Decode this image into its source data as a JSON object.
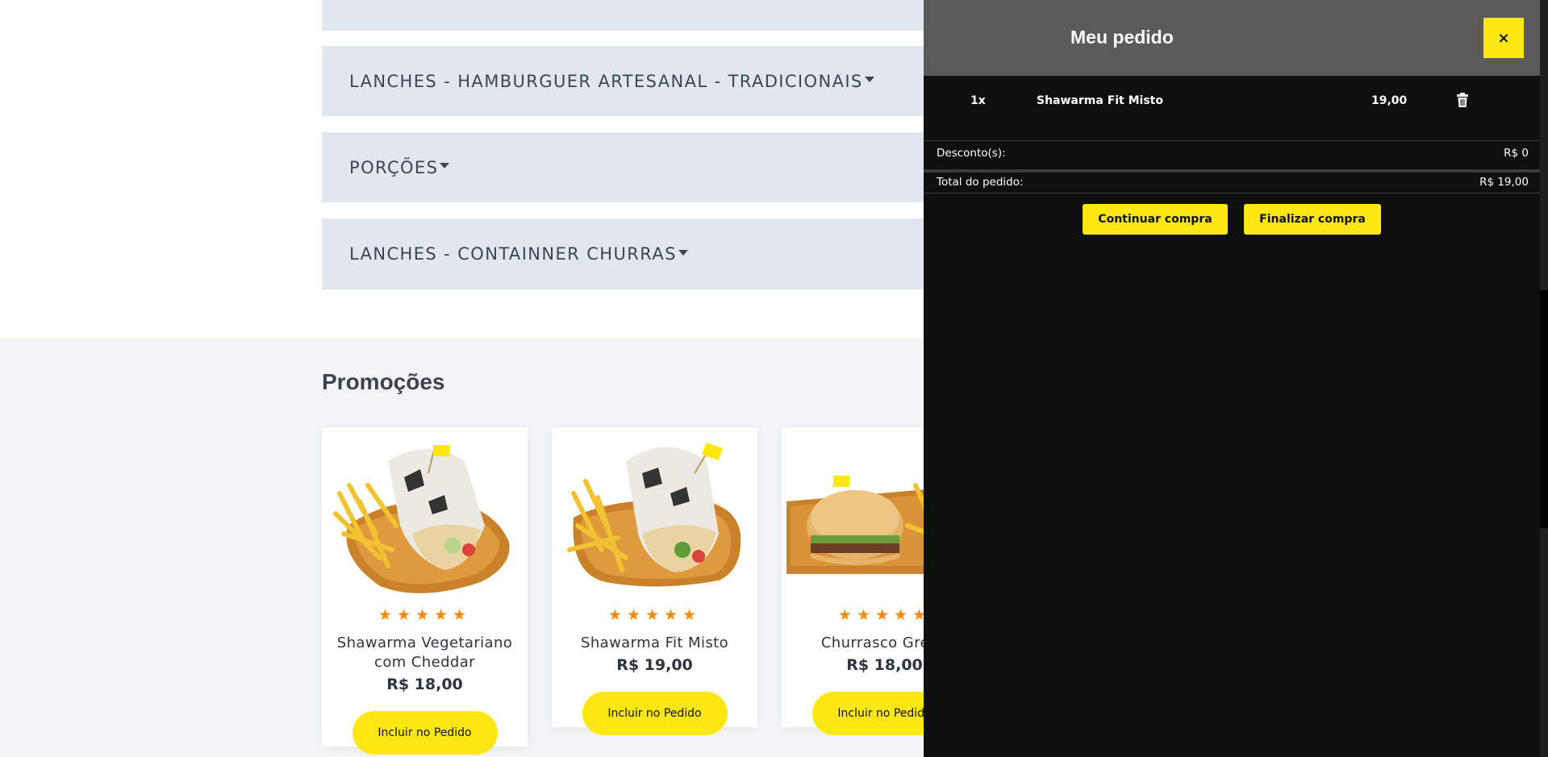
{
  "categories": [
    {
      "label": ""
    },
    {
      "label": "LANCHES - HAMBURGUER ARTESANAL - TRADICIONAIS"
    },
    {
      "label": "PORÇÕES"
    },
    {
      "label": "LANCHES - CONTAINNER CHURRAS"
    }
  ],
  "promotions": {
    "title": "Promoções",
    "products": [
      {
        "name": "Shawarma Vegetariano com Cheddar",
        "price": "R$ 18,00",
        "rating": 5,
        "button": "Incluir no Pedido",
        "image_icon": "wrap-with-fries-image"
      },
      {
        "name": "Shawarma Fit Misto",
        "price": "R$ 19,00",
        "rating": 5,
        "button": "Incluir no Pedido",
        "image_icon": "wrap-with-fries-image"
      },
      {
        "name": "Churrasco Grego",
        "price": "R$ 18,00",
        "rating": 5,
        "button": "Incluir no Pedido",
        "image_icon": "burger-with-fries-image"
      }
    ]
  },
  "drawer": {
    "title": "Meu pedido",
    "close_label": "×",
    "items": [
      {
        "qty": "1x",
        "name": "Shawarma Fit Misto",
        "price": "19,00",
        "delete_icon": "trash-icon"
      }
    ],
    "discount_label": "Desconto(s):",
    "discount_value": "R$ 0",
    "total_label": "Total do pedido:",
    "total_value": "R$ 19,00",
    "continue_label": "Continuar compra",
    "finish_label": "Finalizar compra"
  },
  "colors": {
    "accent_yellow": "#fde713",
    "star_orange": "#f58a07",
    "accordion_bg": "#e1e7ec",
    "drawer_bg": "#0f0f0f",
    "drawer_header_bg": "#5a5a5a"
  }
}
